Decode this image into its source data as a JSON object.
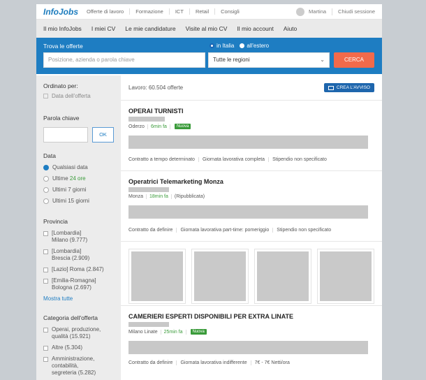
{
  "header": {
    "logo": "InfoJobs",
    "nav": [
      "Offerte di lavoro",
      "Formazione",
      "ICT",
      "Retail",
      "Consigli"
    ],
    "user_name": "Martina",
    "logout": "Chiudi sessione"
  },
  "subnav": [
    "Il mio InfoJobs",
    "I miei CV",
    "Le mie candidature",
    "Visite al mio CV",
    "Il mio account",
    "Aiuto"
  ],
  "search": {
    "title": "Trova le offerte",
    "option_italy": "in Italia",
    "option_abroad": "all'estero",
    "placeholder": "Posizione, azienda o parola chiave",
    "region": "Tutte le regioni",
    "button": "CERCA"
  },
  "sidebar": {
    "sort_title": "Ordinato per:",
    "sort_option": "Data dell'offerta",
    "keyword_title": "Parola chiave",
    "ok": "OK",
    "date_title": "Data",
    "date_options": [
      "Qualsiasi data",
      "Ultime",
      "Ultimi 7 giorni",
      "Ultimi 15 giorni"
    ],
    "date_24": "24 ore",
    "province_title": "Provincia",
    "provinces": [
      {
        "line1": "[Lombardia]",
        "line2": "Milano (9.777)"
      },
      {
        "line1": "[Lombardia]",
        "line2": "Brescia (2.909)"
      },
      {
        "line1": "[Lazio] Roma (2.847)",
        "line2": ""
      },
      {
        "line1": "[Emilia-Romagna]",
        "line2": "Bologna (2.697)"
      }
    ],
    "show_all": "Mostra tutte",
    "category_title": "Categoria dell'offerta",
    "categories": [
      {
        "line1": "Operai, produzione,",
        "line2": "qualità (15.921)",
        "line3": ""
      },
      {
        "line1": "Altre (5.304)",
        "line2": "",
        "line3": ""
      },
      {
        "line1": "Amministrazione,",
        "line2": "contabilità,",
        "line3": "segreteria (5.282)"
      }
    ]
  },
  "results": {
    "count": "Lavoro: 60.504 offerte",
    "alert": "CREA L'AVVISO"
  },
  "offers": [
    {
      "title": "OPERAI TURNISTI",
      "location": "Oderzo",
      "time": "6min fa",
      "badge": "Nuova",
      "tags": [
        "Contratto a tempo determinato",
        "Giornata lavorativa completa",
        "Stipendio non specificato"
      ]
    },
    {
      "title": "Operatrici Telemarketing Monza",
      "location": "Monza",
      "time": "18min fa",
      "badge": "(Ripubblicata)",
      "tags": [
        "Contratto da definire",
        "Giornata lavorativa part-time: pomeriggio",
        "Stipendio non specificato"
      ]
    },
    {
      "title": "CAMERIERI ESPERTI DISPONIBILI PER EXTRA LINATE",
      "location": "Milano Linate",
      "time": "25min fa",
      "badge": "Nuova",
      "tags": [
        "Contratto da definire",
        "Giornata lavorativa indifferente",
        "7€ - 7€ Netti/ora"
      ]
    }
  ],
  "colors": {
    "accent": "#1e7dc2",
    "cta": "#f26a4b",
    "new": "#3a9b3a"
  }
}
